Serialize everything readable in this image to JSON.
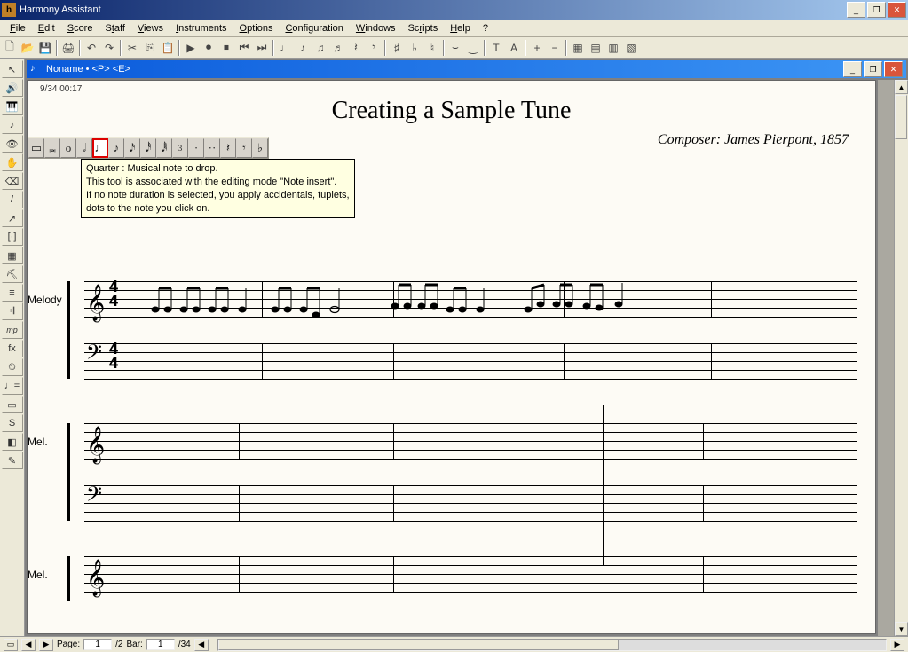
{
  "window": {
    "title": "Harmony Assistant"
  },
  "menubar": [
    {
      "label": "File",
      "key": "F"
    },
    {
      "label": "Edit",
      "key": "E"
    },
    {
      "label": "Score",
      "key": "S"
    },
    {
      "label": "Staff",
      "key": "t"
    },
    {
      "label": "Views",
      "key": "V"
    },
    {
      "label": "Instruments",
      "key": "I"
    },
    {
      "label": "Options",
      "key": "O"
    },
    {
      "label": "Configuration",
      "key": "C"
    },
    {
      "label": "Windows",
      "key": "W"
    },
    {
      "label": "Scripts",
      "key": "r"
    },
    {
      "label": "Help",
      "key": "H"
    },
    {
      "label": "?",
      "key": ""
    }
  ],
  "toolbar_icons": [
    "new",
    "open",
    "save",
    "",
    "print",
    "",
    "undo",
    "redo",
    "",
    "cut",
    "copy",
    "paste",
    "",
    "play",
    "record",
    "stop",
    "rewind",
    "forward",
    "",
    "note",
    "note",
    "note",
    "note",
    "rest",
    "rest",
    "",
    "sharp",
    "flat",
    "natural",
    "",
    "tie",
    "slur",
    "",
    "text",
    "lyrics",
    "",
    "zoom-in",
    "zoom-out",
    "",
    "layout1",
    "layout2",
    "layout3",
    "layout4"
  ],
  "left_palette": [
    "cursor",
    "speaker",
    "piano",
    "note",
    "eye",
    "hand",
    "eraser",
    "line",
    "arrow",
    "bracket",
    "grid",
    "tuning",
    "staves",
    "repeat",
    "mp",
    "fx",
    "metronome",
    "tempo",
    "square",
    "S",
    "color",
    "pencil"
  ],
  "document": {
    "title": "Noname • <P> <E>",
    "page_info": "9/34 00:17",
    "score_title": "Creating a Sample Tune",
    "composer": "Composer: James Pierpont, 1857",
    "staff_labels": {
      "melody": "Melody",
      "mel": "Mel."
    },
    "time_signature": {
      "num": "4",
      "den": "4"
    }
  },
  "note_palette": [
    "▭",
    "𝅗",
    "o",
    "𝅗𝅥",
    "♩",
    "♪",
    "♪",
    "♬",
    "♬",
    "𝄾",
    "·",
    "·",
    "♩.",
    "𝄽",
    "𝄾",
    "♭"
  ],
  "note_palette_selected_index": 4,
  "tooltip": {
    "line1": "Quarter : Musical note to drop.",
    "line2": " This tool is associated with the editing mode \"Note insert\".",
    "line3": "If no note duration is selected, you apply accidentals, tuplets,",
    "line4": "dots to the note you click on."
  },
  "statusbar": {
    "page_label": "Page:",
    "page_current": "1",
    "page_total": "/2",
    "bar_label": "Bar:",
    "bar_current": "1",
    "bar_total": "/34"
  }
}
